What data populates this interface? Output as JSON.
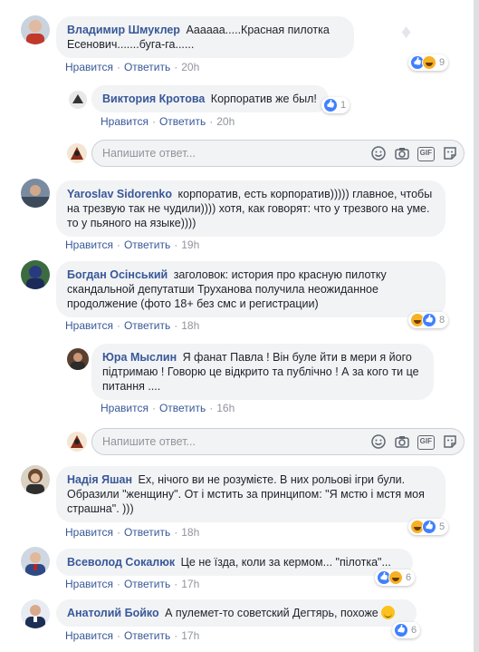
{
  "labels": {
    "like": "Нравится",
    "reply": "Ответить",
    "placeholder": "Напишите ответ..."
  },
  "colors": {
    "link": "#385898",
    "meta": "#90949c",
    "bubble": "#f2f3f5",
    "like": "#4080ff",
    "haha": "#f7b125"
  },
  "comments": [
    {
      "author": "Владимир Шмуклер",
      "text": "Аааааа.....Красная пилотка Есенович.......буга-га......",
      "time": "20h",
      "reactions": [
        "like",
        "haha"
      ],
      "count": "9"
    },
    {
      "author": "Виктория Кротова",
      "text": "Корпоратив же был!",
      "time": "20h",
      "reactions": [
        "like"
      ],
      "count": "1"
    },
    {
      "author": "Yaroslav Sidorenko",
      "text": "корпоратив, есть корпоратив))))) главное, чтобы на трезвую так не чудили)))) хотя, как говорят: что у трезвого на уме. то у пьяного на языке))))",
      "time": "19h"
    },
    {
      "author": "Богдан Осінський",
      "text": "заголовок: история про красную пилотку скандальной депутатши Труханова получила неожиданное продолжение (фото 18+ без смс и регистрации)",
      "time": "18h",
      "reactions": [
        "haha",
        "like"
      ],
      "count": "8"
    },
    {
      "author": "Юра Мыслин",
      "text": "Я фанат Павла ! Він буле йти в мери я його підтримаю ! Говорю це відкрито та публічно ! А за кого ти це питання ....",
      "time": "16h"
    },
    {
      "author": "Надія Яшан",
      "text": "Ех, нічого ви не розумієте. В них рольові ігри були. Образили \"женщину\". От і мстить за принципом: \"Я мстю і мстя моя страшна\". )))",
      "time": "18h",
      "reactions": [
        "haha",
        "like"
      ],
      "count": "5"
    },
    {
      "author": "Всеволод Сокалюк",
      "text": "Це не їзда, коли за кермом... \"пілотка\"...",
      "time": "17h",
      "reactions": [
        "like",
        "haha"
      ],
      "count": "6"
    },
    {
      "author": "Анатолий Бойко",
      "text": "А пулемет-то советский Дегтярь, похоже",
      "time": "17h",
      "reactions": [
        "like"
      ],
      "count": "6"
    }
  ]
}
